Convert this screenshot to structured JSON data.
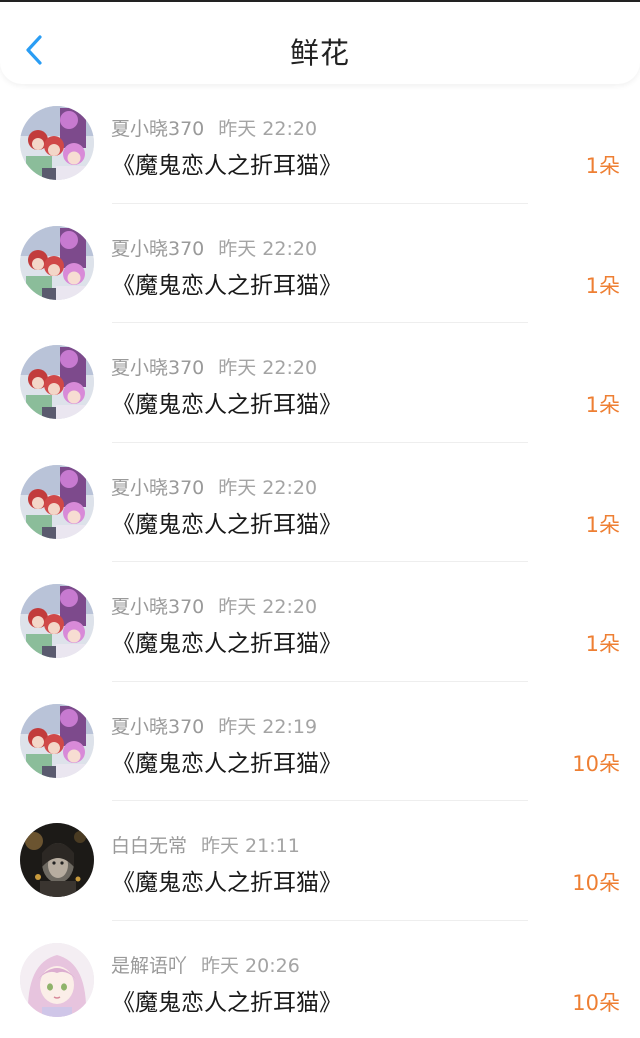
{
  "header": {
    "title": "鲜花",
    "back_icon": "chevron-left-icon",
    "accent": "#2a9df4"
  },
  "colors": {
    "count": "#ee7f33",
    "meta": "#9a9a9a",
    "work": "#1a1a1a"
  },
  "items": [
    {
      "user": "夏小晓370",
      "time": "昨天 22:20",
      "work": "《魔鬼恋人之折耳猫》",
      "count": "1朵",
      "avatar": "anime-group-avatar"
    },
    {
      "user": "夏小晓370",
      "time": "昨天 22:20",
      "work": "《魔鬼恋人之折耳猫》",
      "count": "1朵",
      "avatar": "anime-group-avatar"
    },
    {
      "user": "夏小晓370",
      "time": "昨天 22:20",
      "work": "《魔鬼恋人之折耳猫》",
      "count": "1朵",
      "avatar": "anime-group-avatar"
    },
    {
      "user": "夏小晓370",
      "time": "昨天 22:20",
      "work": "《魔鬼恋人之折耳猫》",
      "count": "1朵",
      "avatar": "anime-group-avatar"
    },
    {
      "user": "夏小晓370",
      "time": "昨天 22:20",
      "work": "《魔鬼恋人之折耳猫》",
      "count": "1朵",
      "avatar": "anime-group-avatar"
    },
    {
      "user": "夏小晓370",
      "time": "昨天 22:19",
      "work": "《魔鬼恋人之折耳猫》",
      "count": "10朵",
      "avatar": "anime-group-avatar"
    },
    {
      "user": "白白无常",
      "time": "昨天 21:11",
      "work": "《魔鬼恋人之折耳猫》",
      "count": "10朵",
      "avatar": "dark-portrait-avatar"
    },
    {
      "user": "是解语吖",
      "time": "昨天 20:26",
      "work": "《魔鬼恋人之折耳猫》",
      "count": "10朵",
      "avatar": "pink-girl-avatar"
    }
  ]
}
